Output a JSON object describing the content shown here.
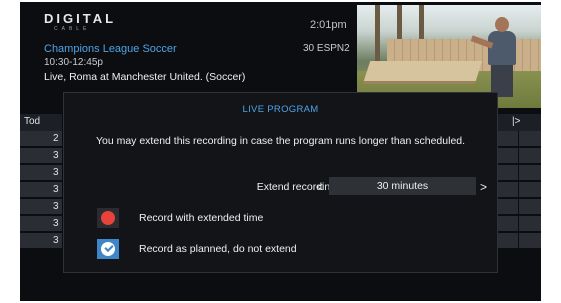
{
  "header": {
    "logo_main": "DIGITAL",
    "logo_sub": "CABLE",
    "clock": "2:01pm"
  },
  "program": {
    "title": "Champions League Soccer",
    "channel": "30 ESPN2",
    "time": "10:30-12:45p",
    "description": "Live, Roma at Manchester United. (Soccer)"
  },
  "guide": {
    "tab_label": "Tod",
    "right_arrow": "|>",
    "rows": [
      "2",
      "3",
      "3",
      "3",
      "3",
      "3",
      "3"
    ]
  },
  "modal": {
    "title": "LIVE PROGRAM",
    "message": "You may extend this recording in case the program runs longer than scheduled.",
    "extend_label": "Extend recording:",
    "extend_value": "30 minutes",
    "arrow_left": "<",
    "arrow_right": ">",
    "options": [
      {
        "label": "Record with extended time",
        "icon": "record-dot-icon",
        "color": "#e8433a"
      },
      {
        "label": "Record as planned, do not extend",
        "icon": "check-circle-icon",
        "color": "#3f86c8"
      }
    ]
  },
  "colors": {
    "accent_blue": "#4da3e8",
    "record_red": "#e8433a",
    "selected_blue": "#3f86c8"
  }
}
